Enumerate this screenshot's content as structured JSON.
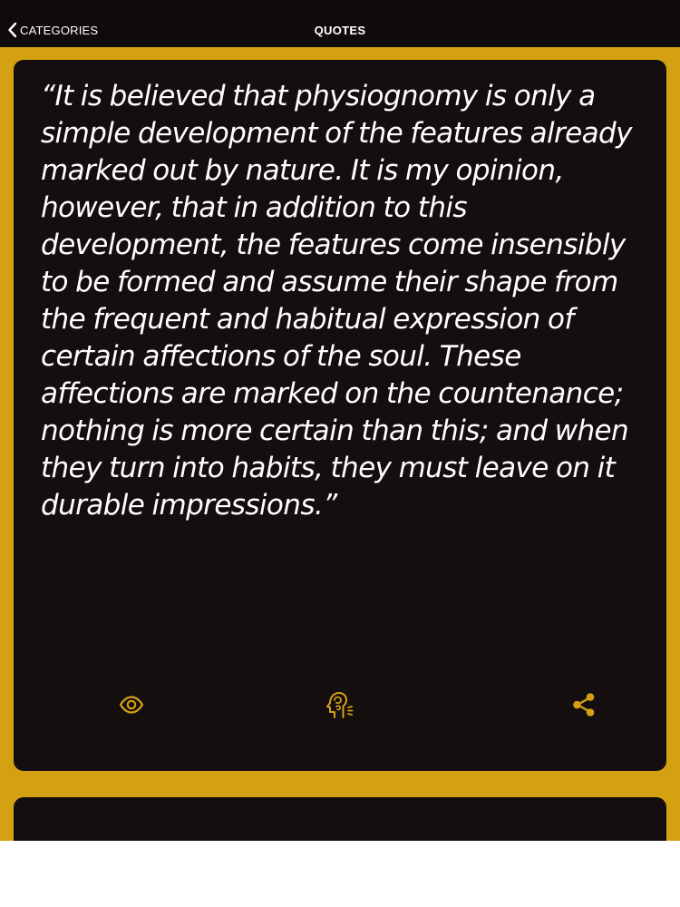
{
  "nav": {
    "back_label": "CATEGORIES",
    "title": "QUOTES"
  },
  "quote": {
    "text": "“It is believed that physiognomy is only a simple development of the features already marked out by nature. It is my opinion, however, that in addition to this development, the features come insensibly to be formed and assume their shape from the frequent and habitual expression of certain affections of the soul. These affections are marked on the countenance; nothing is more certain than this; and when they turn into habits, they must leave on it durable impressions.”"
  },
  "actions": [
    {
      "icon": "eye-icon"
    },
    {
      "icon": "speaking-head-icon"
    },
    {
      "icon": "share-icon"
    }
  ],
  "colors": {
    "background": "#d4a113",
    "card": "#140e0f",
    "nav_bar": "#0f0b0b",
    "accent_icon": "#d4a113",
    "text": "#ffffff"
  }
}
